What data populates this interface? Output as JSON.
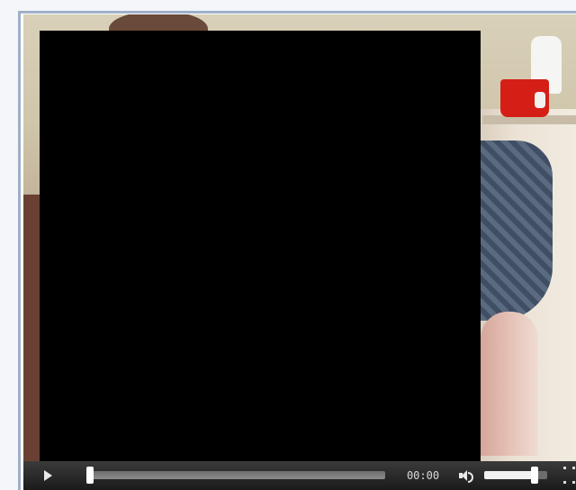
{
  "player": {
    "current_time": "00:00",
    "progress_fraction": 0.0,
    "volume_fraction": 0.8,
    "colors": {
      "control_bar": "#1b1b1b",
      "seek_track": "#7a7a7a",
      "accent": "#ffffff",
      "redaction": "#000000"
    },
    "icons": {
      "play": "play-icon",
      "volume": "volume-icon",
      "fullscreen": "fullscreen-icon"
    }
  }
}
